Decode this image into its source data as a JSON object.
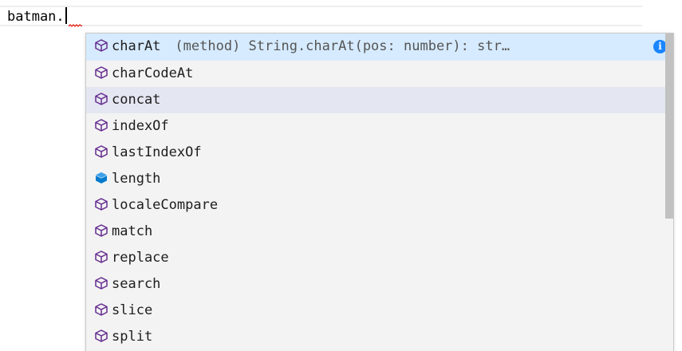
{
  "editor": {
    "code_text": "batman.",
    "colors": {
      "squiggle": "#e51400",
      "method_icon": "#652d90",
      "property_icon": "#007acc",
      "focused_row": "#d6ebff",
      "info_icon": "#1a85ff"
    }
  },
  "suggest": {
    "items": [
      {
        "label": "charAt",
        "kind": "method",
        "detail": "(method) String.charAt(pos: number): str…",
        "icon": "method-cube-icon"
      },
      {
        "label": "charCodeAt",
        "kind": "method",
        "icon": "method-cube-icon"
      },
      {
        "label": "concat",
        "kind": "method",
        "icon": "method-cube-icon"
      },
      {
        "label": "indexOf",
        "kind": "method",
        "icon": "method-cube-icon"
      },
      {
        "label": "lastIndexOf",
        "kind": "method",
        "icon": "method-cube-icon"
      },
      {
        "label": "length",
        "kind": "property",
        "icon": "property-cube-icon"
      },
      {
        "label": "localeCompare",
        "kind": "method",
        "icon": "method-cube-icon"
      },
      {
        "label": "match",
        "kind": "method",
        "icon": "method-cube-icon"
      },
      {
        "label": "replace",
        "kind": "method",
        "icon": "method-cube-icon"
      },
      {
        "label": "search",
        "kind": "method",
        "icon": "method-cube-icon"
      },
      {
        "label": "slice",
        "kind": "method",
        "icon": "method-cube-icon"
      },
      {
        "label": "split",
        "kind": "method",
        "icon": "method-cube-icon"
      }
    ],
    "info_glyph": "i"
  }
}
